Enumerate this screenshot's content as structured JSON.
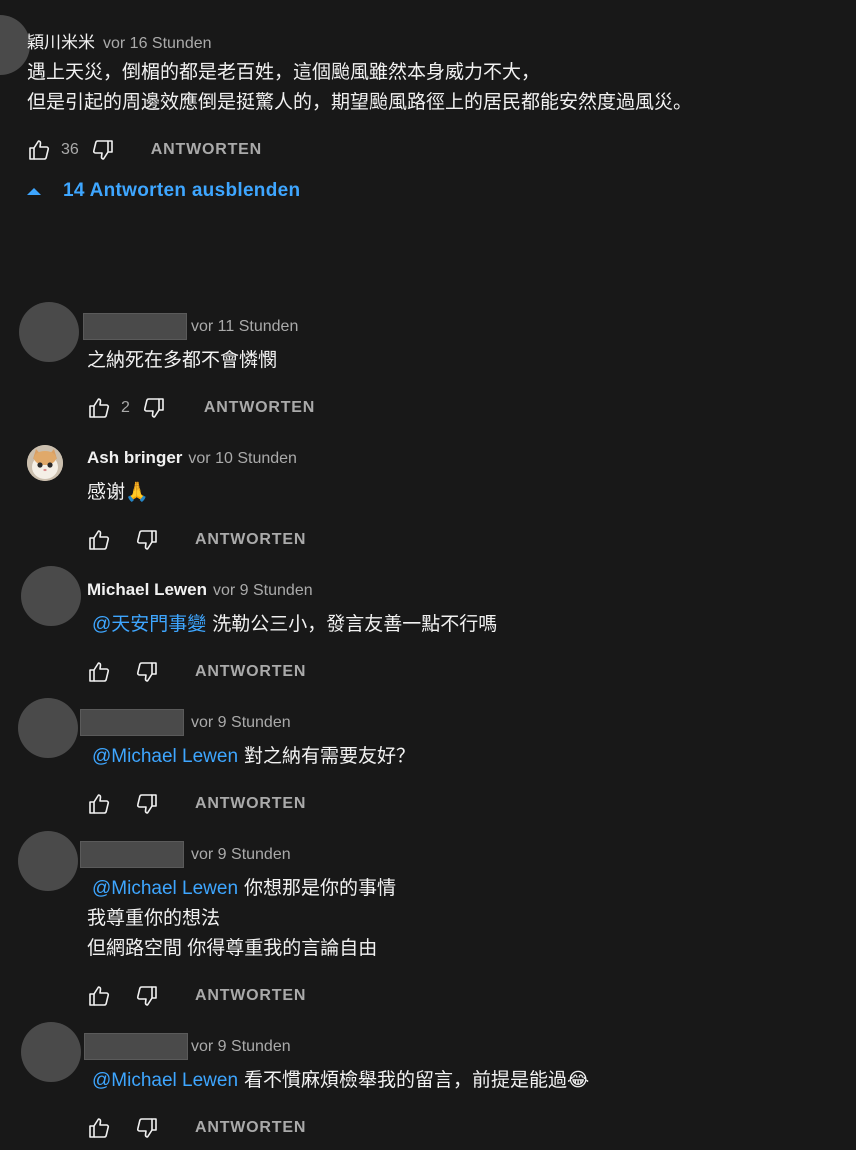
{
  "top_comment": {
    "author": "穎川米米",
    "time": "vor 16 Stunden",
    "lines": [
      "遇上天災，倒楣的都是老百姓，這個颱風雖然本身威力不大，",
      "但是引起的周邊效應倒是挺驚人的，期望颱風路徑上的居民都能安然度過風災。"
    ],
    "likes": "36",
    "reply_label": "ANTWORTEN",
    "toggle_label": "14 Antworten ausblenden"
  },
  "replies": [
    {
      "author": "",
      "time": "vor 11 Stunden",
      "mention": "",
      "lines": [
        "之納死在多都不會憐憫"
      ],
      "likes": "2",
      "reply_label": "ANTWORTEN"
    },
    {
      "author": "Ash bringer",
      "time": "vor 10 Stunden",
      "mention": "",
      "lines": [
        "感谢"
      ],
      "emoji": "🙏",
      "likes": "",
      "reply_label": "ANTWORTEN"
    },
    {
      "author": "Michael Lewen",
      "time": "vor 9 Stunden",
      "mention": "@天安門事變",
      "lines": [
        "洗勒公三小，發言友善一點不行嗎"
      ],
      "likes": "",
      "reply_label": "ANTWORTEN"
    },
    {
      "author": "",
      "time": "vor 9 Stunden",
      "mention": "@Michael Lewen",
      "lines": [
        "對之納有需要友好？"
      ],
      "likes": "",
      "reply_label": "ANTWORTEN"
    },
    {
      "author": "",
      "time": "vor 9 Stunden",
      "mention": "@Michael Lewen",
      "lines": [
        "你想那是你的事情",
        "我尊重你的想法",
        "但網路空間 你得尊重我的言論自由"
      ],
      "likes": "",
      "reply_label": "ANTWORTEN"
    },
    {
      "author": "",
      "time": "vor 9 Stunden",
      "mention": "@Michael Lewen",
      "lines": [
        "看不慣麻煩檢舉我的留言，前提是能過"
      ],
      "emoji": "😂",
      "likes": "",
      "reply_label": "ANTWORTEN"
    }
  ],
  "colors": {
    "background": "#181818",
    "text": "#f1f1f1",
    "secondary": "#aaaaaa",
    "link": "#3ea6ff"
  }
}
